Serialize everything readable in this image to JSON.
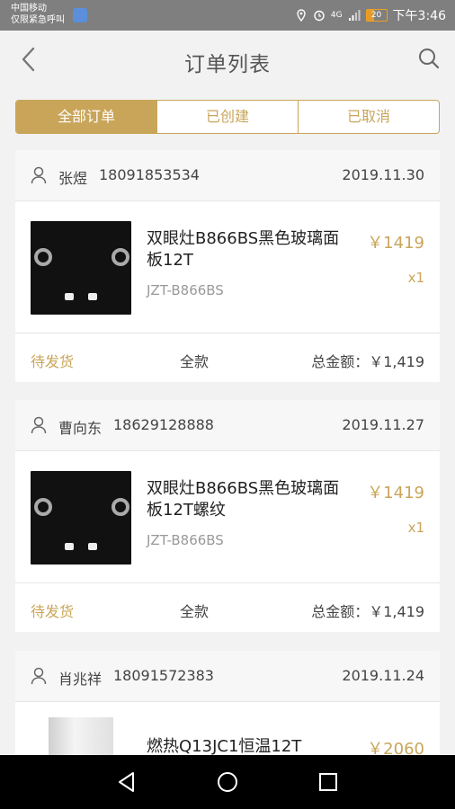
{
  "status_bar": {
    "carrier_line1": "中国移动",
    "carrier_line2": "仅限紧急呼叫",
    "signal_label": "4G",
    "battery": "20",
    "time": "下午3:46"
  },
  "header": {
    "title": "订单列表"
  },
  "tabs": [
    {
      "label": "全部订单",
      "active": true
    },
    {
      "label": "已创建",
      "active": false
    },
    {
      "label": "已取消",
      "active": false
    }
  ],
  "orders": [
    {
      "name": "张煜",
      "phone": "18091853534",
      "date": "2019.11.30",
      "product": "双眼灶B866BS黑色玻璃面板12T",
      "sku": "JZT-B866BS",
      "price": "￥1419",
      "qty": "x1",
      "status": "待发货",
      "pay_type": "全款",
      "total": "总金额：￥1,419"
    },
    {
      "name": "曹向东",
      "phone": "18629128888",
      "date": "2019.11.27",
      "product": "双眼灶B866BS黑色玻璃面板12T螺纹",
      "sku": "JZT-B866BS",
      "price": "￥1419",
      "qty": "x1",
      "status": "待发货",
      "pay_type": "全款",
      "total": "总金额：￥1,419"
    },
    {
      "name": "肖兆祥",
      "phone": "18091572383",
      "date": "2019.11.24",
      "product": "燃热Q13JC1恒温12T",
      "price": "￥2060"
    }
  ],
  "colors": {
    "accent": "#c9a55a",
    "background": "#f2f2f2",
    "status_bar": "#7f7f7f"
  }
}
